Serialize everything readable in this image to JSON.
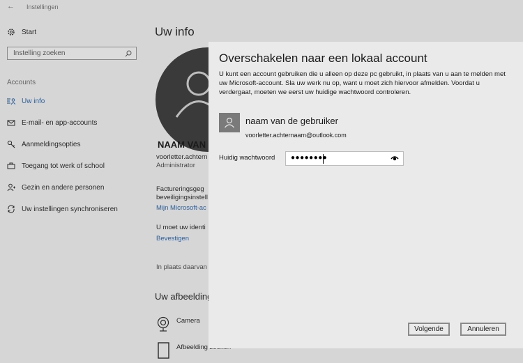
{
  "window": {
    "title": "Instellingen",
    "back_icon": "back-arrow-icon"
  },
  "sidebar": {
    "home_label": "Start",
    "search_placeholder": "Instelling zoeken",
    "section_label": "Accounts",
    "items": [
      {
        "label": "Uw info",
        "icon": "user-info-icon",
        "selected": true
      },
      {
        "label": "E-mail- en app-accounts",
        "icon": "mail-icon"
      },
      {
        "label": "Aanmeldingsopties",
        "icon": "key-icon"
      },
      {
        "label": "Toegang tot werk of school",
        "icon": "briefcase-icon"
      },
      {
        "label": "Gezin en andere personen",
        "icon": "person-add-icon"
      },
      {
        "label": "Uw instellingen synchroniseren",
        "icon": "sync-icon"
      }
    ]
  },
  "main": {
    "title": "Uw info",
    "name": "NAAM VAN",
    "email": "voorletter.achtern",
    "role": "Administrator",
    "billing_line1": "Factureringsgeg",
    "billing_line2": "beveiligingsinstell",
    "ms_account_link": "Mijn Microsoft-ac",
    "verify_text": "U moet uw identi",
    "verify_link": "Bevestigen",
    "instead_text": "In plaats daarvan",
    "picture_heading": "Uw afbeelding",
    "camera_label": "Camera",
    "browse_label": "Afbeelding zoeken"
  },
  "dialog": {
    "title": "Overschakelen naar een lokaal account",
    "description": "U kunt een account gebruiken die u alleen op deze pc gebruikt, in plaats van u aan te melden met uw Microsoft-account. Sla uw werk nu op, want u moet zich hiervoor afmelden. Voordat u verdergaat, moeten we eerst uw huidige wachtwoord controleren.",
    "account_name": "naam van de gebruiker",
    "account_email": "voorletter.achternaam@outlook.com",
    "password_label": "Huidig wachtwoord",
    "password_mask": "●●●●●●●●",
    "next_button": "Volgende",
    "cancel_button": "Annuleren"
  }
}
